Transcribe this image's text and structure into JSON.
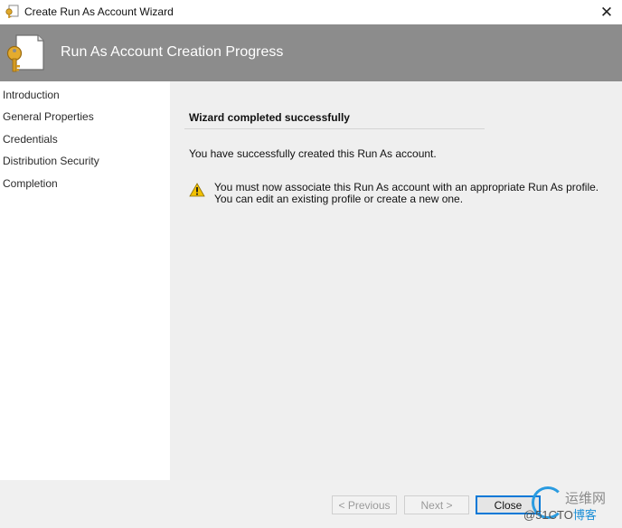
{
  "window": {
    "title": "Create Run As Account Wizard",
    "close_glyph": "✕"
  },
  "banner": {
    "title": "Run As Account Creation Progress",
    "icon": "key-document-icon"
  },
  "sidebar": {
    "items": [
      {
        "label": "Introduction"
      },
      {
        "label": "General Properties"
      },
      {
        "label": "Credentials"
      },
      {
        "label": "Distribution Security"
      },
      {
        "label": "Completion"
      }
    ]
  },
  "main": {
    "heading": "Wizard completed successfully",
    "message": "You have successfully created this Run As account.",
    "warning": {
      "icon": "warning-icon",
      "line1": "You must now associate this Run As account with an appropriate Run As profile.",
      "line2": "You can edit an existing profile or create a new one."
    }
  },
  "footer": {
    "previous_label": "< Previous",
    "next_label": "Next >",
    "close_label": "Close"
  },
  "watermark": {
    "top_text": "运维网",
    "bottom_prefix": "@51CTO",
    "bottom_suffix": "博客"
  },
  "colors": {
    "banner": "#8c8c8c",
    "content_bg": "#efefef",
    "accent": "#0078d7",
    "warning": "#f2c100"
  }
}
